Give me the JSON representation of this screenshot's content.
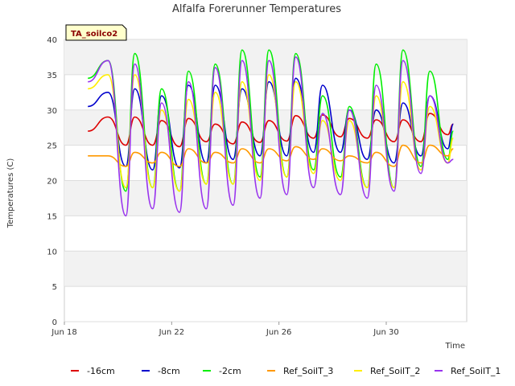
{
  "chart_data": {
    "type": "line",
    "title": "Alfalfa Forerunner Temperatures",
    "xlabel": "Time",
    "ylabel": "Temperatures (C)",
    "badge": "TA_soilco2",
    "ylim": [
      0,
      40
    ],
    "y_ticks": [
      0,
      5,
      10,
      15,
      20,
      25,
      30,
      35,
      40
    ],
    "xlim": [
      "2024-06-18",
      "2024-07-03"
    ],
    "x_ticks": [
      {
        "date": "2024-06-18",
        "label": "Jun 18"
      },
      {
        "date": "2024-06-22",
        "label": "Jun 22"
      },
      {
        "date": "2024-06-26",
        "label": "Jun 26"
      },
      {
        "date": "2024-06-30",
        "label": "Jun 30"
      }
    ],
    "grid": true,
    "legend_position": "bottom",
    "x": [
      "06-18 21:00",
      "06-19 15:00",
      "06-20 07:00",
      "06-20 15:00",
      "06-21 07:00",
      "06-21 15:00",
      "06-22 07:00",
      "06-22 15:00",
      "06-23 07:00",
      "06-23 15:00",
      "06-24 07:00",
      "06-24 15:00",
      "06-25 07:00",
      "06-25 15:00",
      "06-26 07:00",
      "06-26 15:00",
      "06-27 07:00",
      "06-27 15:00",
      "06-28 07:00",
      "06-28 15:00",
      "06-29 07:00",
      "06-29 15:00",
      "06-30 07:00",
      "06-30 15:00",
      "07-01 07:00",
      "07-01 15:00",
      "07-02 07:00",
      "07-02 12:00"
    ],
    "series": [
      {
        "name": "-16cm",
        "color": "#dd0000",
        "values": [
          27.0,
          29.0,
          25.0,
          29.0,
          25.0,
          28.5,
          24.8,
          28.8,
          25.5,
          28.0,
          25.2,
          28.3,
          25.4,
          28.5,
          25.6,
          29.2,
          26.0,
          29.3,
          26.2,
          28.8,
          26.0,
          28.6,
          25.5,
          28.6,
          25.5,
          29.5,
          26.5,
          28.0
        ]
      },
      {
        "name": "-8cm",
        "color": "#0000cc",
        "values": [
          30.5,
          32.5,
          22.0,
          33.0,
          21.5,
          32.0,
          21.8,
          33.5,
          22.5,
          33.5,
          23.0,
          33.0,
          23.5,
          34.0,
          23.5,
          34.5,
          24.0,
          33.5,
          24.0,
          30.0,
          23.0,
          30.0,
          22.5,
          31.0,
          23.5,
          32.0,
          24.5,
          28.0
        ]
      },
      {
        "name": "-2cm",
        "color": "#00ee00",
        "values": [
          34.5,
          37.0,
          18.5,
          38.0,
          19.0,
          33.0,
          18.5,
          35.5,
          19.5,
          36.5,
          19.5,
          38.5,
          20.5,
          38.5,
          20.5,
          38.0,
          21.5,
          32.0,
          20.5,
          30.5,
          19.0,
          36.5,
          19.0,
          38.5,
          22.0,
          35.5,
          23.0,
          27.0
        ]
      },
      {
        "name": "Ref_SoilT_3",
        "color": "#ff9900",
        "values": [
          23.5,
          23.5,
          22.0,
          24.0,
          22.5,
          24.0,
          22.0,
          24.5,
          22.5,
          24.0,
          22.5,
          24.5,
          22.5,
          24.5,
          22.8,
          24.8,
          23.0,
          24.5,
          22.8,
          23.5,
          22.5,
          24.0,
          22.0,
          25.0,
          22.5,
          25.0,
          23.5,
          24.5
        ]
      },
      {
        "name": "Ref_SoilT_2",
        "color": "#ffee00",
        "values": [
          33.0,
          35.0,
          19.0,
          35.0,
          19.0,
          30.0,
          18.5,
          31.5,
          19.5,
          32.5,
          19.5,
          34.0,
          20.0,
          35.0,
          20.5,
          34.0,
          21.0,
          28.5,
          20.0,
          28.5,
          19.0,
          32.0,
          19.0,
          34.0,
          21.5,
          30.5,
          22.5,
          26.0
        ]
      },
      {
        "name": "Ref_SoilT_1",
        "color": "#9933ee",
        "values": [
          34.0,
          37.0,
          15.0,
          36.5,
          16.0,
          31.0,
          15.5,
          34.0,
          16.0,
          36.0,
          16.5,
          37.0,
          17.5,
          37.0,
          18.0,
          37.5,
          19.0,
          29.5,
          18.0,
          30.0,
          17.5,
          33.5,
          18.5,
          37.0,
          21.0,
          32.0,
          22.5,
          23.0
        ]
      }
    ]
  }
}
